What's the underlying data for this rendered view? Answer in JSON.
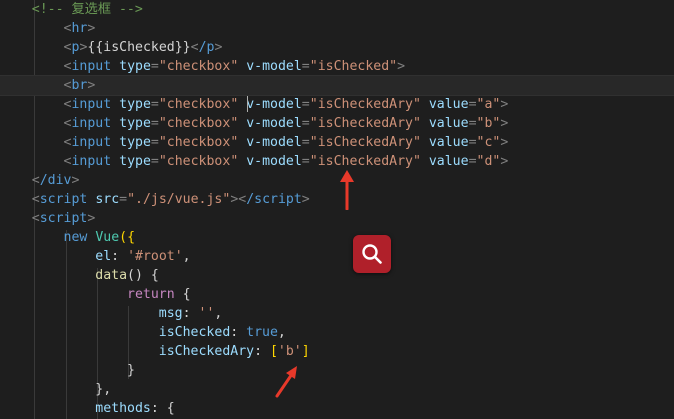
{
  "colors": {
    "background": "#1e1e1e",
    "comment": "#6a9955",
    "tag": "#569cd6",
    "attribute": "#9cdcfe",
    "string": "#ce9178",
    "punctuation": "#808080",
    "annotation_arrow": "#e8392a",
    "search_button": "#b0202a"
  },
  "icons": {
    "search": "search-icon",
    "arrow": "arrow-annotation"
  },
  "code": {
    "comment": "<!-- 复选框 -->",
    "hr": "hr",
    "p_open": "p",
    "mustache": "{{isChecked}}",
    "p_close": "/p",
    "input": "input",
    "type_attr": "type",
    "checkbox_value": "\"checkbox\"",
    "vmodel_attr": "v-model",
    "is_checked": "\"isChecked\"",
    "br": "br",
    "is_checked_ary": "\"isCheckedAry\"",
    "value_attr": "value",
    "val_a": "\"a\"",
    "val_b": "\"b\"",
    "val_c": "\"c\"",
    "val_d": "\"d\"",
    "div_close": "/div",
    "script": "script",
    "src_attr": "src",
    "src_value": "\"./js/vue.js\"",
    "script_close": "/script",
    "new_kw": "new",
    "vue": "Vue",
    "open_call": "({",
    "el_key": "el",
    "el_value": "'#root'",
    "data_fn": "data",
    "data_sig": "() {",
    "return_kw": "return",
    "open_brace": "{",
    "msg_key": "msg",
    "msg_value": "''",
    "is_checked_key": "isChecked",
    "true_value": "true",
    "is_checked_ary_key": "isCheckedAry",
    "ary_open": "[",
    "ary_value": "'b'",
    "ary_close": "]",
    "close_brace": "}",
    "close_brace_comma": "},",
    "methods_key": "methods",
    "methods_open": "{"
  }
}
